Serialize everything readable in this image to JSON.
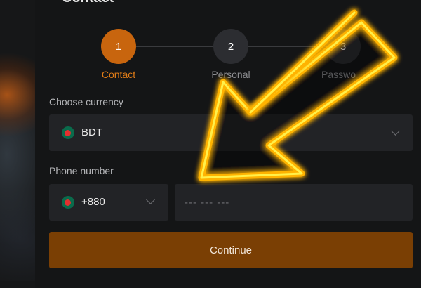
{
  "form": {
    "heading": "Contact",
    "steps": [
      {
        "number": "1",
        "label": "Contact",
        "state": "active"
      },
      {
        "number": "2",
        "label": "Personal",
        "state": "inactive"
      },
      {
        "number": "3",
        "label": "Passwo",
        "state": "inactive"
      }
    ],
    "currency": {
      "label": "Choose currency",
      "value": "BDT",
      "flag_icon": "bangladesh-flag-icon"
    },
    "phone": {
      "label": "Phone number",
      "country_code": "+880",
      "placeholder": "--- --- ---",
      "value": ""
    },
    "continue_label": "Continue"
  },
  "colors": {
    "accent": "#c8650e",
    "accent_text": "#e17c16",
    "button_bg": "#7a3f04",
    "field_bg": "#222326",
    "panel_bg": "#141516",
    "arrow": "#ffd400"
  },
  "overlay": {
    "arrow_icon": "glowing-arrow-icon",
    "direction": "down-left"
  }
}
